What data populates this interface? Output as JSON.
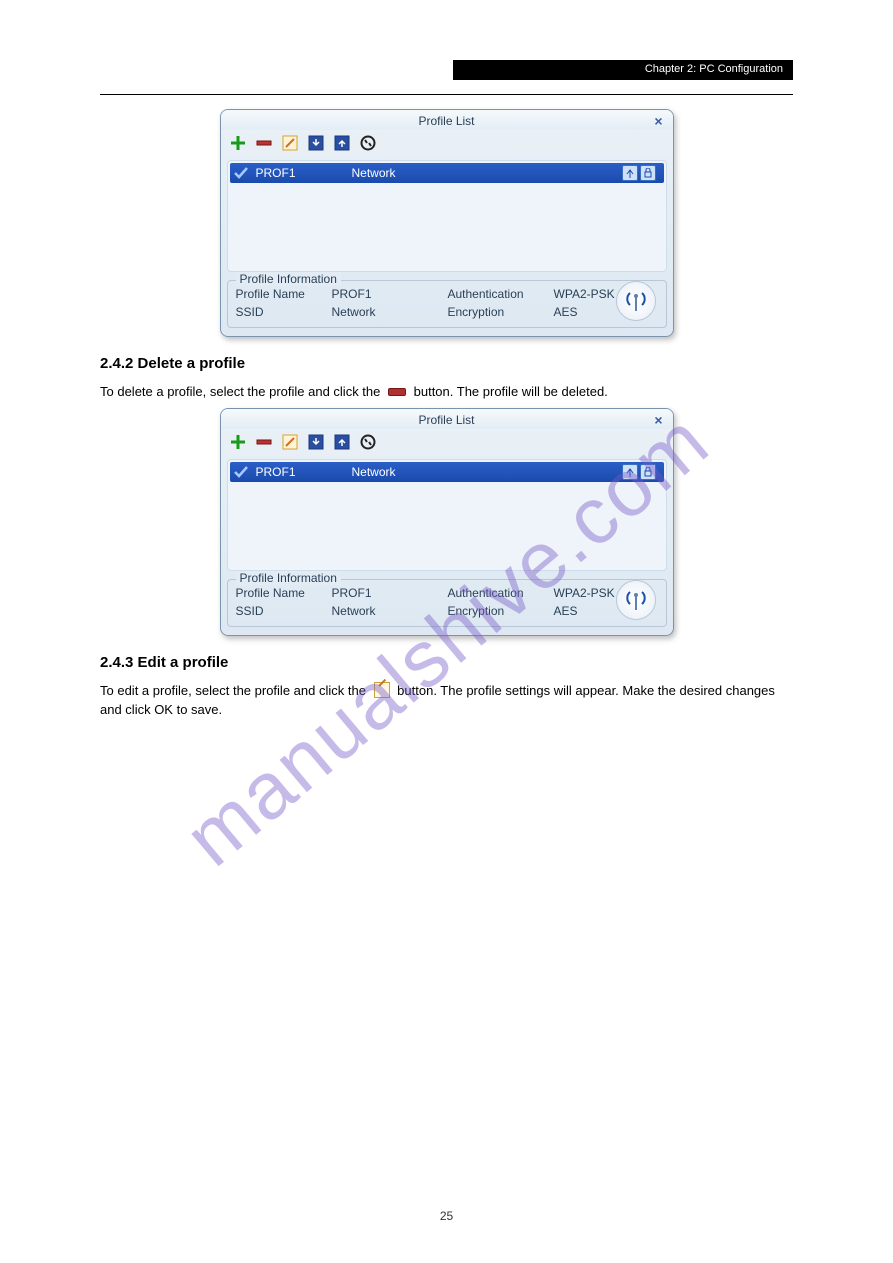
{
  "header": {
    "blackbar": "Chapter 2: PC Configuration"
  },
  "watermark": "manualshive.com",
  "section": {
    "delete_title": "2.4.2 Delete a profile",
    "delete_text_before": "To delete a profile, select the profile and click the ",
    "delete_text_after": " button. The profile will be deleted.",
    "edit_title": "2.4.3 Edit a profile",
    "edit_text_before": "To edit a profile, select the profile and click the ",
    "edit_text_after": " button. The profile settings will appear. Make the desired changes and click OK to save."
  },
  "panel": {
    "title": "Profile List",
    "row": {
      "name": "PROF1",
      "ssid": "Network"
    },
    "info": {
      "legend": "Profile Information",
      "l1": "Profile Name",
      "v1": "PROF1",
      "l2": "Authentication",
      "v2": "WPA2-PSK",
      "l3": "SSID",
      "v3": "Network",
      "l4": "Encryption",
      "v4": "AES"
    }
  },
  "footer": "25"
}
